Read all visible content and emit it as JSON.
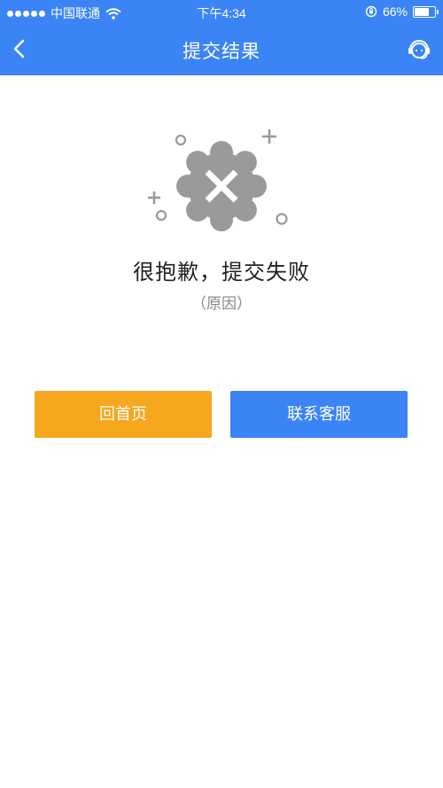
{
  "status_bar": {
    "carrier": "中国联通",
    "time": "下午4:34",
    "battery": "66%",
    "battery_level": 0.66
  },
  "nav": {
    "title": "提交结果",
    "back_icon": "chevron-left-icon",
    "service_icon": "customer-service-icon"
  },
  "result": {
    "icon": "error-badge-icon",
    "title": "很抱歉，提交失败",
    "reason": "（原因）"
  },
  "actions": {
    "home_label": "回首页",
    "service_label": "联系客服"
  },
  "colors": {
    "primary": "#3b84f5",
    "warning": "#f7a71e",
    "icon_gray": "#9a9a9a"
  }
}
